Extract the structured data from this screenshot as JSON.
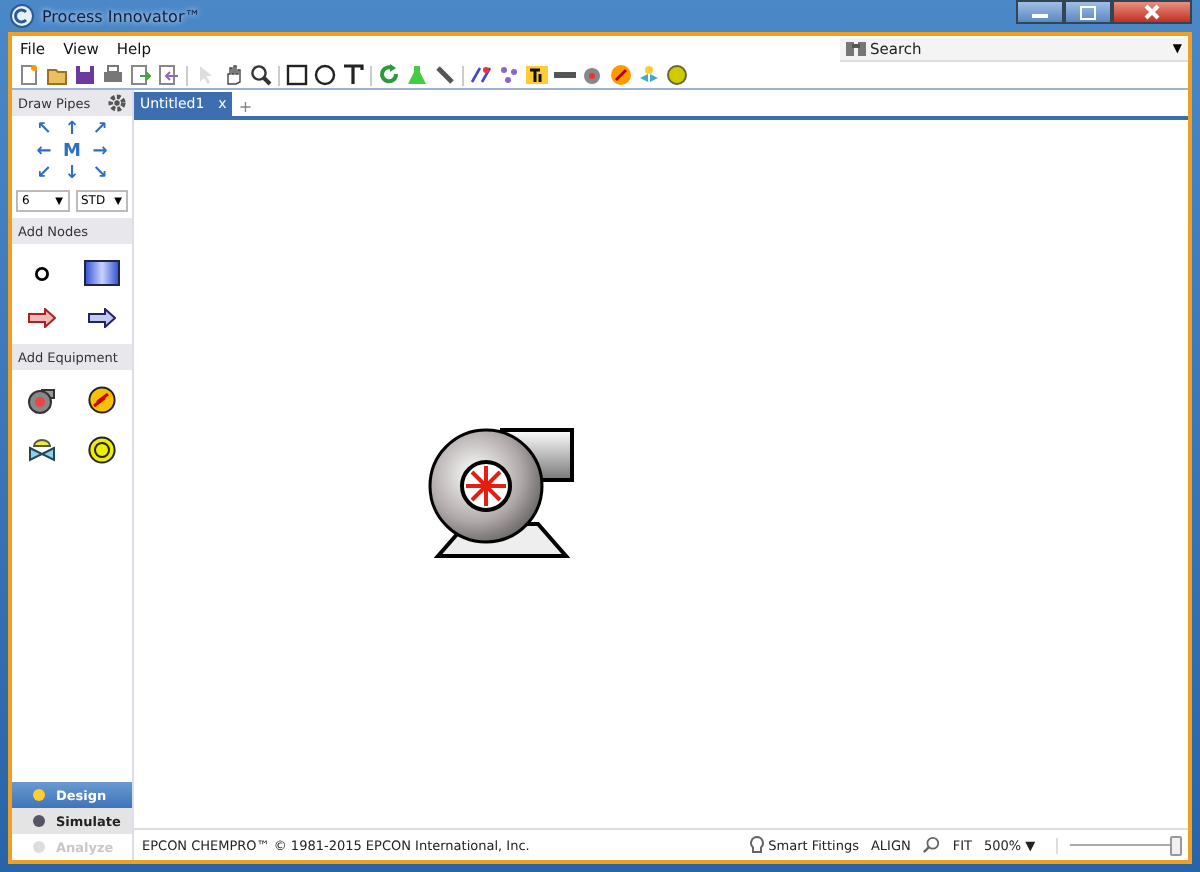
{
  "window": {
    "title": "Process Innovator™"
  },
  "menu": [
    {
      "label": "File"
    },
    {
      "label": "View"
    },
    {
      "label": "Help"
    }
  ],
  "search": {
    "placeholder": "Search",
    "caret": "▼"
  },
  "sidebar": {
    "draw_pipes": "Draw Pipes",
    "directions": [
      "↖",
      "↑",
      "↗",
      "←",
      "M",
      "→",
      "↙",
      "↓",
      "↘"
    ],
    "selects": [
      {
        "value": "6",
        "caret": "▼"
      },
      {
        "value": "STD",
        "caret": "▼"
      }
    ],
    "add_nodes": "Add Nodes",
    "add_equipment": "Add Equipment",
    "modes": [
      {
        "label": "Design",
        "selected": true,
        "disabled": false
      },
      {
        "label": "Simulate",
        "selected": false,
        "disabled": false
      },
      {
        "label": "Analyze",
        "selected": false,
        "disabled": true
      }
    ]
  },
  "tabs": [
    {
      "label": "Untitled1",
      "selected": true,
      "close": "x"
    }
  ],
  "new_tab": "+",
  "status_bar": {
    "copyright": "EPCON CHEMPRO™ © 1981-2015 EPCON International, Inc.",
    "smart_fittings": "Smart Fittings",
    "align": "ALIGN",
    "fit": "FIT",
    "zoom": "500%",
    "zoom_caret": "▼",
    "zoom_slider": {
      "level": 0.95
    }
  }
}
